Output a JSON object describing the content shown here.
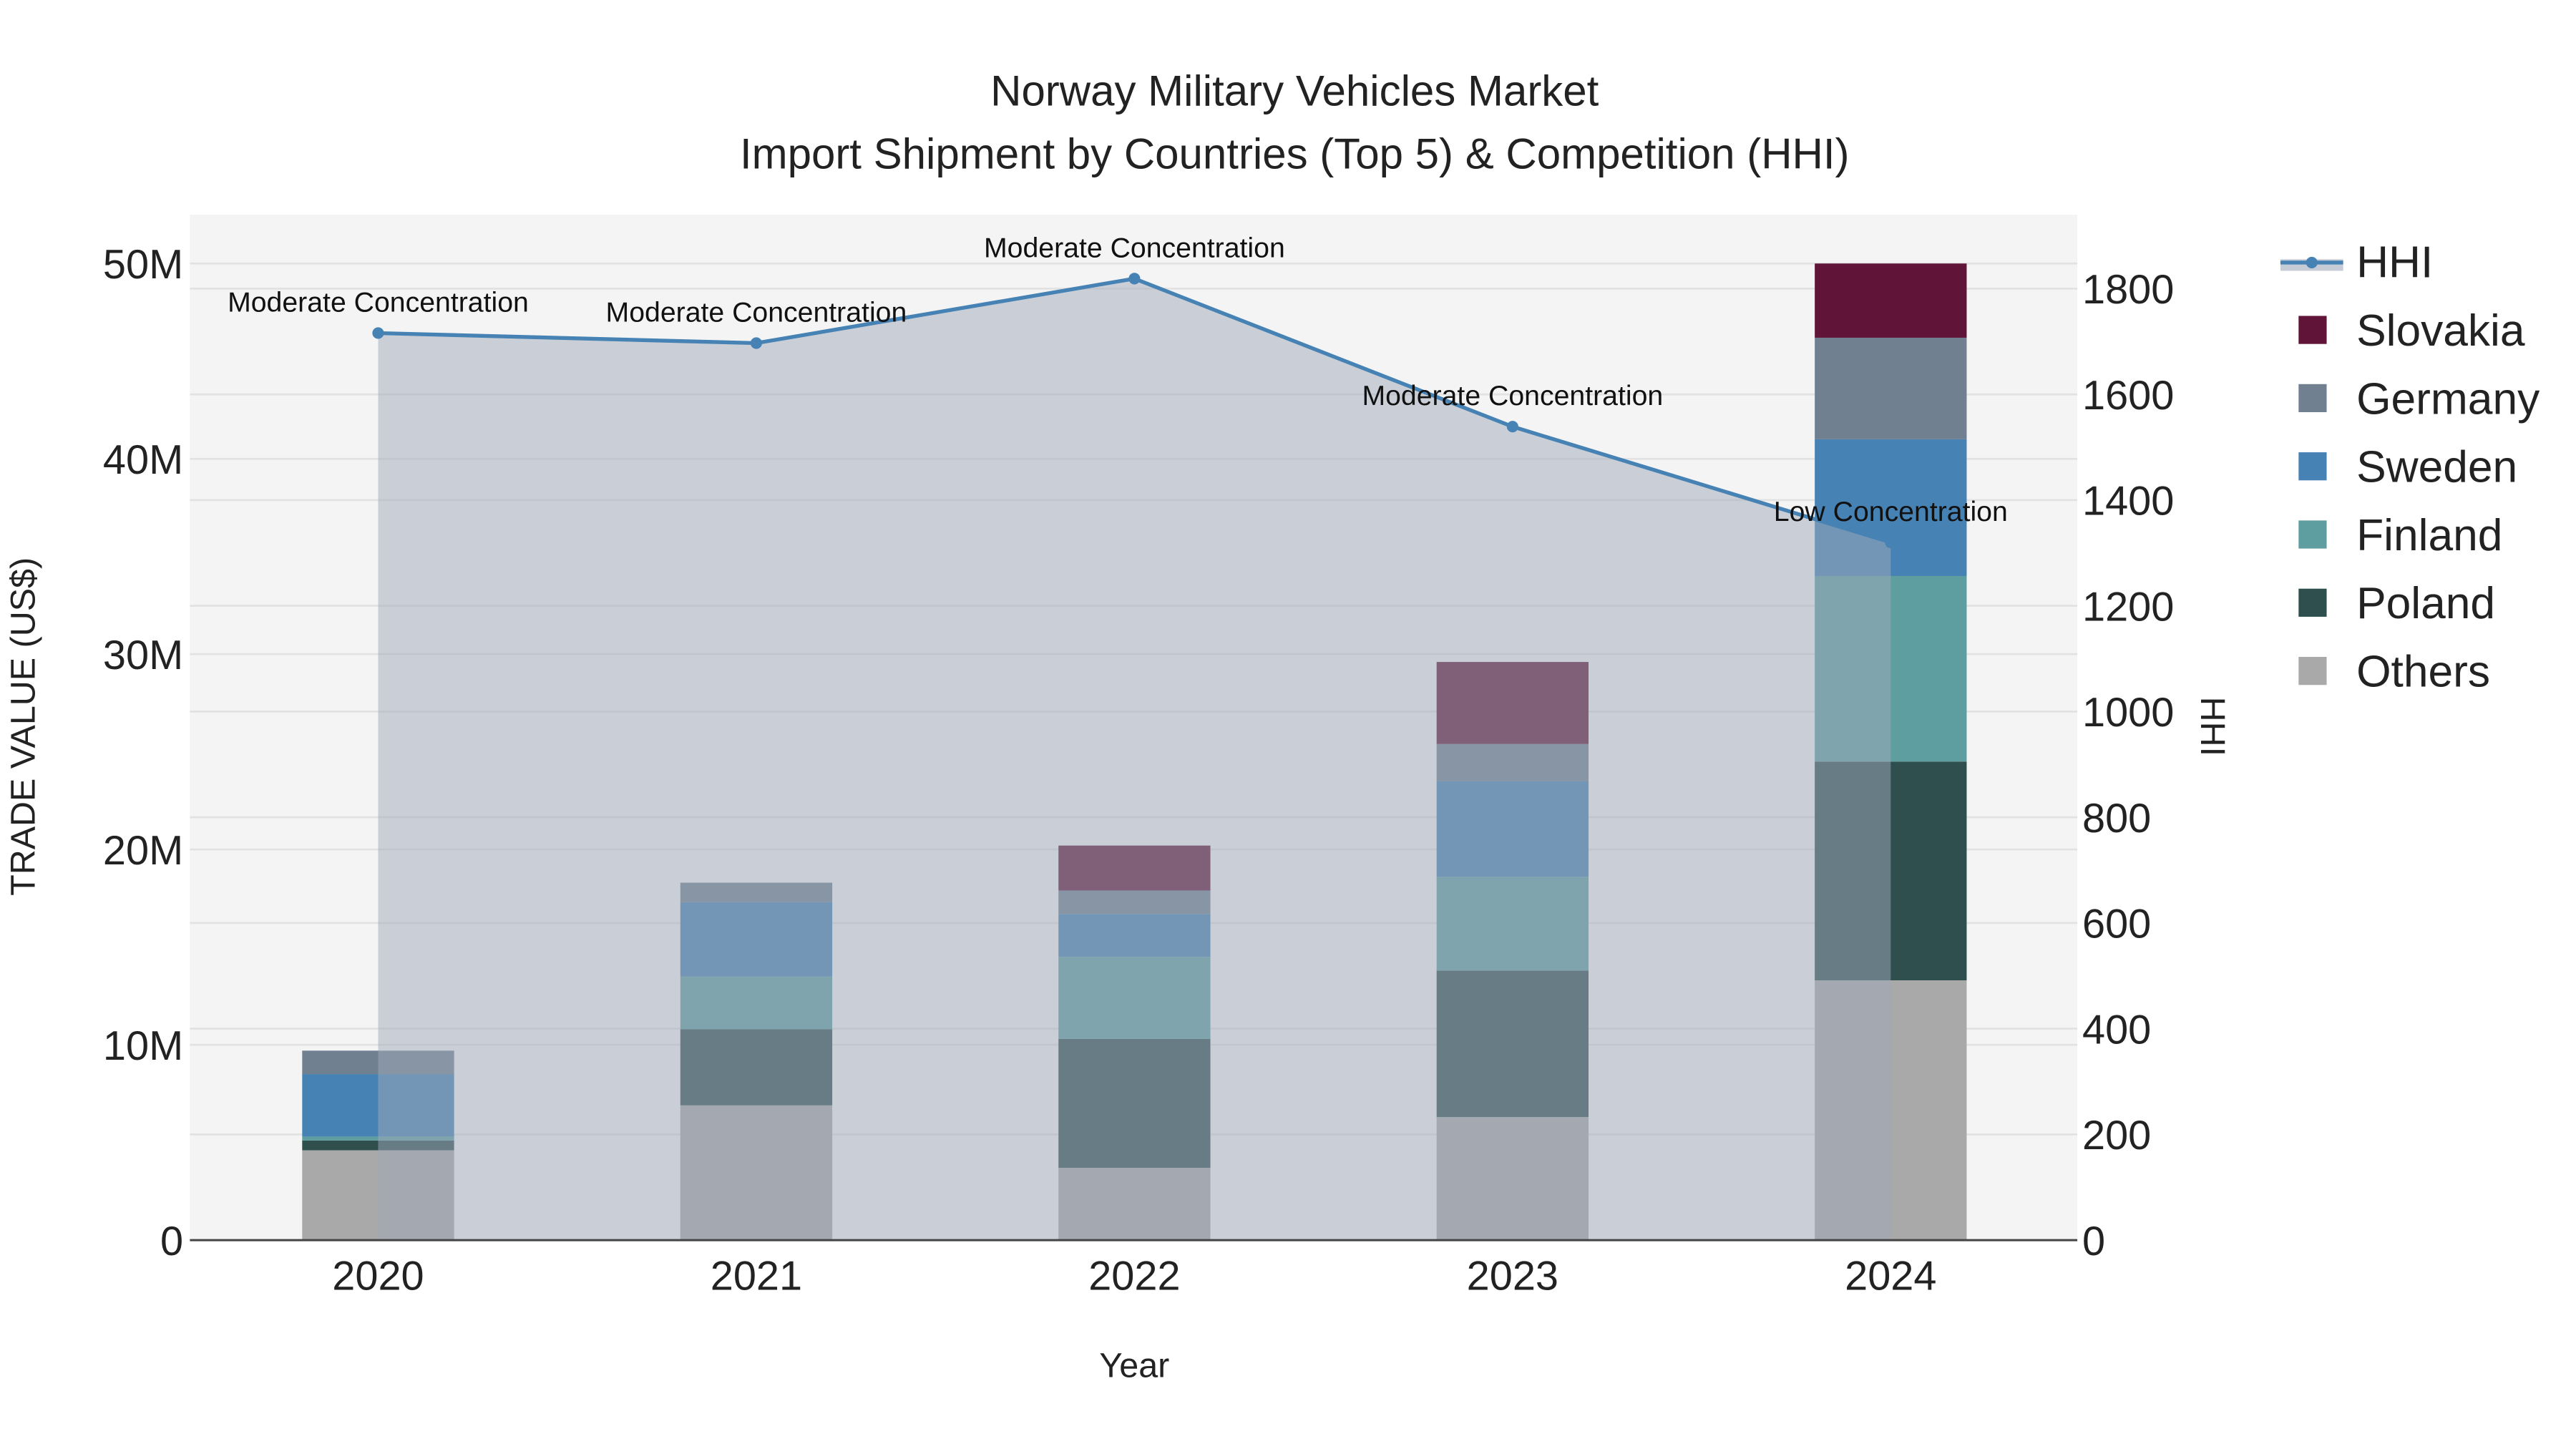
{
  "chart_data": {
    "type": "bar",
    "title": "Norway Military Vehicles Market",
    "subtitle": "Import Shipment by Countries (Top 5) & Competition (HHI)",
    "xlabel": "Year",
    "ylabel": "TRADE VALUE (US$)",
    "y2label": "HHI",
    "categories": [
      "2020",
      "2021",
      "2022",
      "2023",
      "2024"
    ],
    "ylim": [
      0,
      52.5
    ],
    "y_ticks": [
      0,
      10,
      20,
      30,
      40,
      50
    ],
    "y_tick_labels": [
      "0",
      "10M",
      "20M",
      "30M",
      "40M",
      "50M"
    ],
    "y2lim": [
      0,
      1940
    ],
    "y2_ticks": [
      0,
      200,
      400,
      600,
      800,
      1000,
      1200,
      1400,
      1600,
      1800
    ],
    "y2_tick_labels": [
      "0",
      "200",
      "400",
      "600",
      "800",
      "1000",
      "1200",
      "1400",
      "1600",
      "1800"
    ],
    "units": "million US$",
    "series": [
      {
        "name": "Others",
        "color": "#a9a9a9",
        "values": [
          4.6,
          6.9,
          3.7,
          6.3,
          13.3
        ]
      },
      {
        "name": "Poland",
        "color": "#2f4f4f",
        "values": [
          0.5,
          3.9,
          6.6,
          7.5,
          11.2
        ]
      },
      {
        "name": "Finland",
        "color": "#5f9ea0",
        "values": [
          0.2,
          2.7,
          4.2,
          4.8,
          9.5
        ]
      },
      {
        "name": "Sweden",
        "color": "#4682b4",
        "values": [
          3.2,
          3.8,
          2.2,
          4.9,
          7.0
        ]
      },
      {
        "name": "Germany",
        "color": "#708090",
        "values": [
          1.2,
          1.0,
          1.2,
          1.9,
          5.2
        ]
      },
      {
        "name": "Slovakia",
        "color": "#601538",
        "values": [
          0,
          0,
          2.3,
          4.2,
          3.8
        ]
      }
    ],
    "hhi": {
      "name": "HHI",
      "color": "#4682b4",
      "values": [
        1716,
        1697,
        1819,
        1539,
        1320
      ],
      "annotations": [
        "Moderate Concentration",
        "Moderate Concentration",
        "Moderate Concentration",
        "Moderate Concentration",
        "Low Concentration"
      ]
    },
    "legend": {
      "position": "right",
      "order": [
        "HHI",
        "Slovakia",
        "Germany",
        "Sweden",
        "Finland",
        "Poland",
        "Others"
      ]
    },
    "grid": true
  }
}
